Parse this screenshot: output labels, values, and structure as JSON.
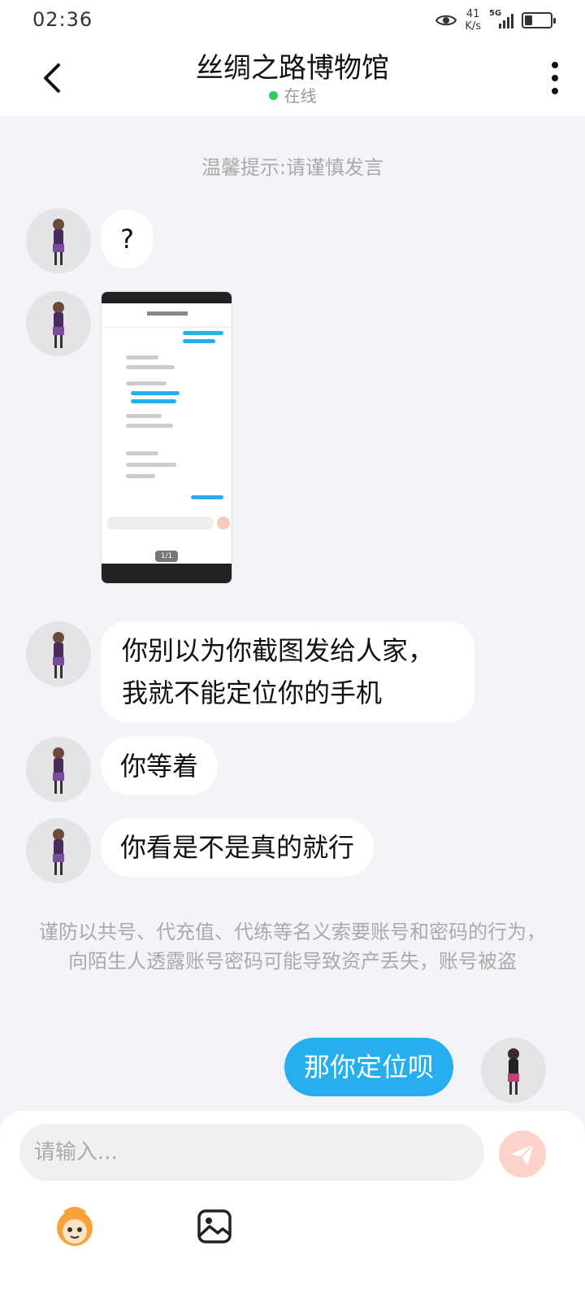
{
  "status_bar": {
    "time": "02:36",
    "net_speed_value": "41",
    "net_speed_unit": "K/s",
    "network": "5G",
    "battery_level": 0.3
  },
  "header": {
    "title": "丝绸之路博物馆",
    "status": "在线"
  },
  "tips": {
    "top": "温馨提示:请谨慎发言",
    "warning": "谨防以共号、代充值、代练等名义索要账号和密码的行为，向陌生人透露账号密码可能导致资产丢失，账号被盗"
  },
  "messages": [
    {
      "sender": "other",
      "text": "?"
    },
    {
      "sender": "other",
      "type": "image",
      "page_indicator": "1/1"
    },
    {
      "sender": "other",
      "text": "你别以为你截图发给人家，\n我就不能定位你的手机"
    },
    {
      "sender": "other",
      "text": "你等着"
    },
    {
      "sender": "other",
      "text": "你看是不是真的就行"
    },
    {
      "sender": "self",
      "text": "那你定位呗"
    }
  ],
  "input": {
    "placeholder": "请输入..."
  },
  "icons": {
    "back": "back-chevron-icon",
    "more": "more-vertical-icon",
    "send": "send-paper-plane-icon",
    "mascot": "monkey-mascot-icon",
    "image": "image-icon"
  },
  "colors": {
    "accent": "#26aef0",
    "online": "#33cc55",
    "send_button": "#fbd3cb",
    "background": "#f2f4f7"
  }
}
